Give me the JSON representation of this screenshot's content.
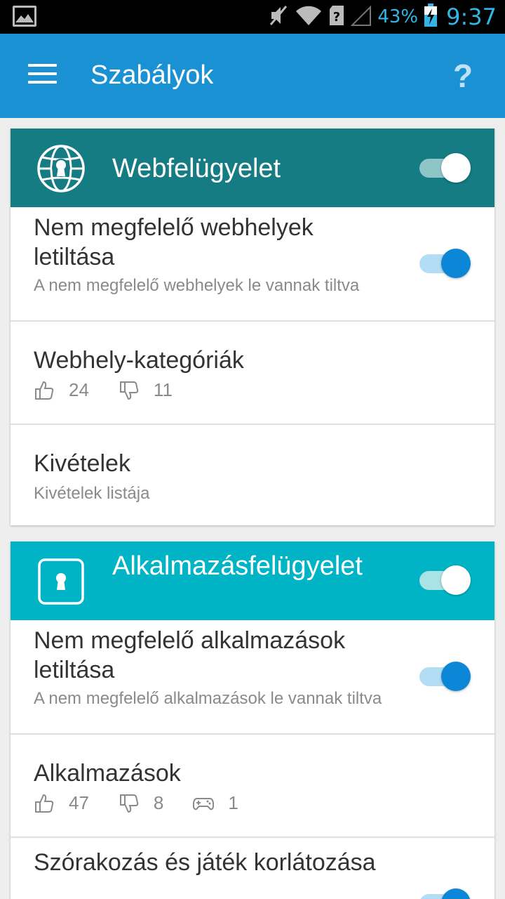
{
  "status_bar": {
    "battery_percent": "43%",
    "time": "9:37",
    "icons": [
      "gallery-icon",
      "mute-icon",
      "wifi-icon",
      "unknown-sim-icon",
      "signal-icon",
      "battery-charging-icon"
    ]
  },
  "app_bar": {
    "title": "Szabályok",
    "help_label": "?"
  },
  "colors": {
    "app_bar": "#1a91d3",
    "web_header": "#147c82",
    "app_header": "#00b4c6",
    "toggle_blue": "#0c87d8"
  },
  "web_card": {
    "title": "Webfelügyelet",
    "enabled": true,
    "block_title": "Nem megfelelő webhelyek letiltása",
    "block_sub": "A nem megfelelő webhelyek le vannak tiltva",
    "block_enabled": true,
    "categories_title": "Webhely-kategóriák",
    "allowed_count": "24",
    "blocked_count": "11",
    "exceptions_title": "Kivételek",
    "exceptions_sub": "Kivételek listája"
  },
  "app_card": {
    "title": "Alkalmazásfelügyelet",
    "enabled": true,
    "block_title": "Nem megfelelő alkalmazások letiltása",
    "block_sub": "A nem megfelelő alkalmazások le vannak tiltva",
    "block_enabled": true,
    "apps_title": "Alkalmazások",
    "allowed_count": "47",
    "blocked_count": "8",
    "games_count": "1",
    "games_title": "Szórakozás és játék korlátozása",
    "games_enabled": true
  }
}
